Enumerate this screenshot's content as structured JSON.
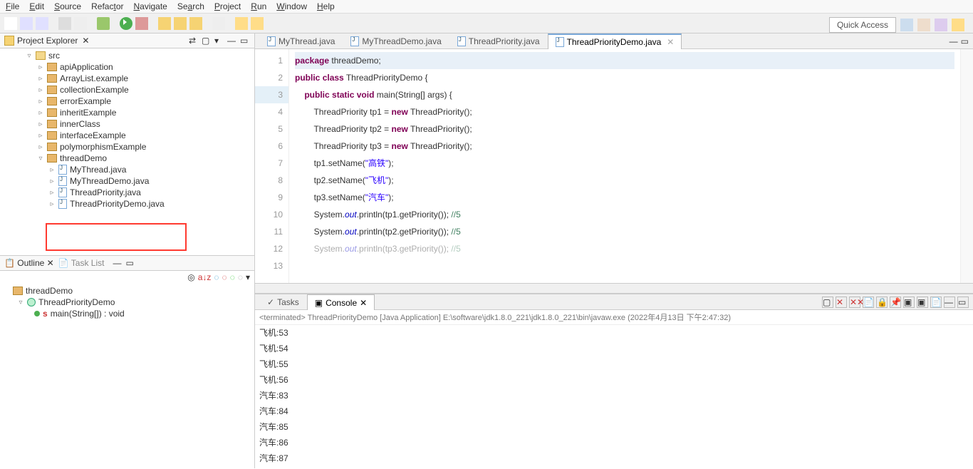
{
  "menu": {
    "file": "File",
    "edit": "Edit",
    "source": "Source",
    "refactor": "Refactor",
    "navigate": "Navigate",
    "search": "Search",
    "project": "Project",
    "run": "Run",
    "window": "Window",
    "help": "Help"
  },
  "quickAccess": "Quick Access",
  "projectExplorer": {
    "title": "Project Explorer",
    "tree": {
      "src": "src",
      "packages": [
        "apiApplication",
        "ArrayList.example",
        "collectionExample",
        "errorExample",
        "inheritExample",
        "innerClass",
        "interfaceExample",
        "polymorphismExample"
      ],
      "expandedPackage": {
        "name": "threadDemo",
        "files": [
          "MyThread.java",
          "MyThreadDemo.java",
          "ThreadPriority.java",
          "ThreadPriorityDemo.java"
        ]
      }
    }
  },
  "outline": {
    "title": "Outline",
    "taskList": "Task List",
    "items": {
      "pkg": "threadDemo",
      "cls": "ThreadPriorityDemo",
      "method": "main(String[]) : void"
    }
  },
  "editorTabs": {
    "t1": "MyThread.java",
    "t2": "MyThreadDemo.java",
    "t3": "ThreadPriority.java",
    "t4": "ThreadPriorityDemo.java"
  },
  "code": {
    "ln1_a": "package",
    "ln1_b": " threadDemo;",
    "ln2_a": "public",
    "ln2_b": " ",
    "ln2_c": "class",
    "ln2_d": " ThreadPriorityDemo {",
    "ln3_a": "    ",
    "ln3_b": "public",
    "ln3_c": " ",
    "ln3_d": "static",
    "ln3_e": " ",
    "ln3_f": "void",
    "ln3_g": " main(String[] args) {",
    "ln4_a": "        ThreadPriority tp1 = ",
    "ln4_b": "new",
    "ln4_c": " ThreadPriority();",
    "ln5_a": "        ThreadPriority tp2 = ",
    "ln5_b": "new",
    "ln5_c": " ThreadPriority();",
    "ln6_a": "        ThreadPriority tp3 = ",
    "ln6_b": "new",
    "ln6_c": " ThreadPriority();",
    "ln7": "",
    "ln8_a": "        tp1.setName(",
    "ln8_b": "\"高铁\"",
    "ln8_c": ");",
    "ln9_a": "        tp2.setName(",
    "ln9_b": "\"飞机\"",
    "ln9_c": ");",
    "ln10_a": "        tp3.setName(",
    "ln10_b": "\"汽车\"",
    "ln10_c": ");",
    "ln11_a": "        System.",
    "ln11_b": "out",
    "ln11_c": ".println(tp1.getPriority()); ",
    "ln11_d": "//5",
    "ln12_a": "        System.",
    "ln12_b": "out",
    "ln12_c": ".println(tp2.getPriority()); ",
    "ln12_d": "//5",
    "ln13_a": "        System.",
    "ln13_b": "out",
    "ln13_c": ".println(tp3.getPriority()); ",
    "ln13_d": "//5"
  },
  "lineNumbers": [
    "1",
    "2",
    "3",
    "4",
    "5",
    "6",
    "7",
    "8",
    "9",
    "10",
    "11",
    "12",
    "13"
  ],
  "bottom": {
    "tasks": "Tasks",
    "console": "Console",
    "status": "<terminated> ThreadPriorityDemo [Java Application] E:\\software\\jdk1.8.0_221\\jdk1.8.0_221\\bin\\javaw.exe (2022年4月13日 下午2:47:32)",
    "output": [
      "飞机:53",
      "飞机:54",
      "飞机:55",
      "飞机:56",
      "汽车:83",
      "汽车:84",
      "汽车:85",
      "汽车:86",
      "汽车:87"
    ]
  }
}
